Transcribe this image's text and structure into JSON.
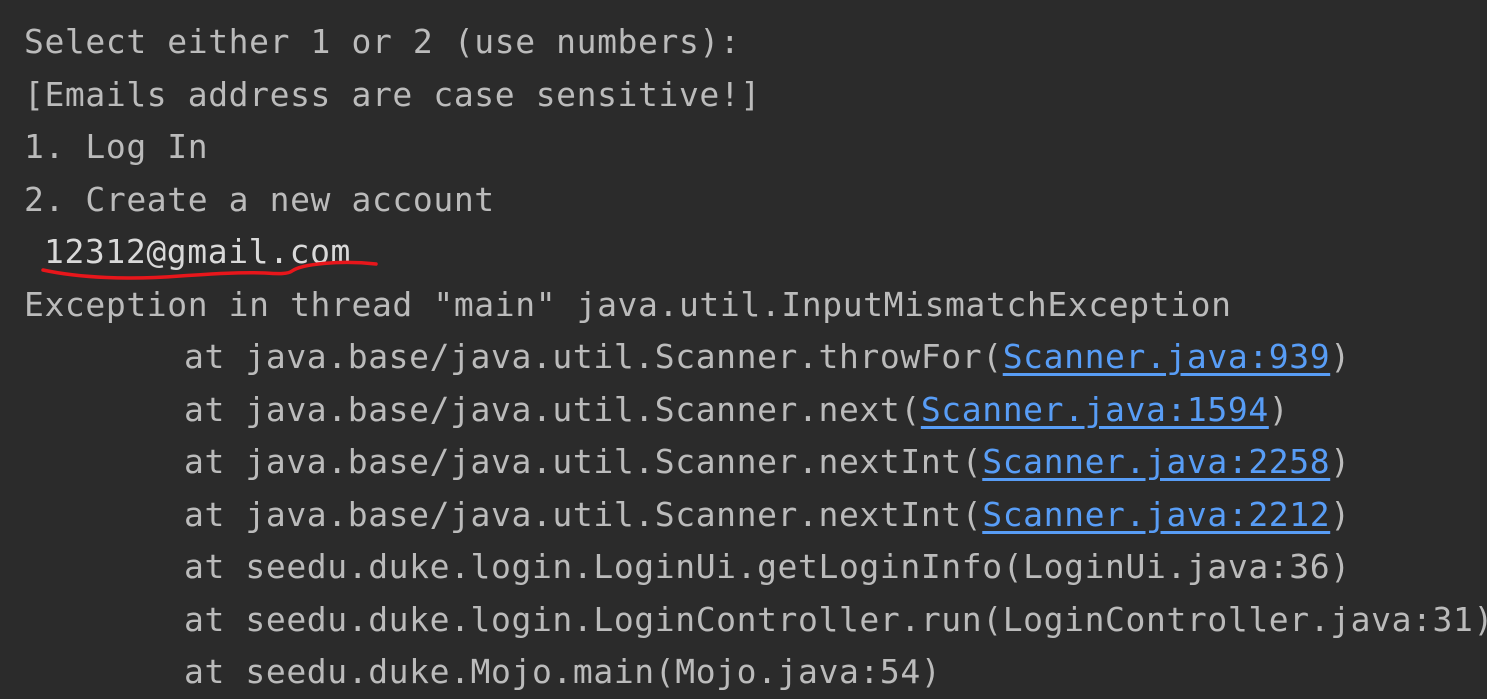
{
  "console": {
    "prompt_lines": [
      "Select either 1 or 2 (use numbers):",
      "[Emails address are case sensitive!]",
      "1. Log In",
      "2. Create a new account"
    ],
    "user_input": "12312@gmail.com",
    "exception_header": "Exception in thread \"main\" java.util.InputMismatchException",
    "stack": [
      {
        "prefix": "at java.base/java.util.Scanner.throwFor(",
        "link": "Scanner.java:939",
        "suffix": ")"
      },
      {
        "prefix": "at java.base/java.util.Scanner.next(",
        "link": "Scanner.java:1594",
        "suffix": ")"
      },
      {
        "prefix": "at java.base/java.util.Scanner.nextInt(",
        "link": "Scanner.java:2258",
        "suffix": ")"
      },
      {
        "prefix": "at java.base/java.util.Scanner.nextInt(",
        "link": "Scanner.java:2212",
        "suffix": ")"
      },
      {
        "prefix": "at seedu.duke.login.LoginUi.getLoginInfo(LoginUi.java:36)",
        "link": "",
        "suffix": ""
      },
      {
        "prefix": "at seedu.duke.login.LoginController.run(LoginController.java:31)",
        "link": "",
        "suffix": ""
      },
      {
        "prefix": "at seedu.duke.Mojo.main(Mojo.java:54)",
        "link": "",
        "suffix": ""
      }
    ]
  },
  "colors": {
    "background": "#2b2b2b",
    "text": "#bbbbbb",
    "link": "#589df6",
    "annotation": "#e8161b"
  }
}
